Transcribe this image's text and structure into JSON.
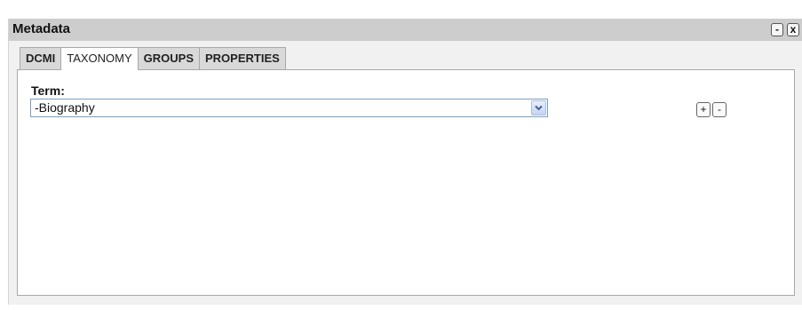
{
  "window": {
    "title": "Metadata",
    "minimize_label": "-",
    "close_label": "x"
  },
  "tabs": [
    {
      "label": "DCMI",
      "active": false
    },
    {
      "label": "TAXONOMY",
      "active": true
    },
    {
      "label": "GROUPS",
      "active": false
    },
    {
      "label": "PROPERTIES",
      "active": false
    }
  ],
  "taxonomy": {
    "term_label": "Term:",
    "term_select": {
      "selected_value": "-Biography"
    },
    "add_label": "+",
    "remove_label": "-"
  },
  "colors": {
    "titlebar": "#cdcdcd",
    "inactive_tab": "#d9d9d9",
    "active_tab": "#ffffff",
    "select_border": "#7f9db9"
  },
  "icons": {
    "select_arrow": "chevron-down-icon"
  }
}
